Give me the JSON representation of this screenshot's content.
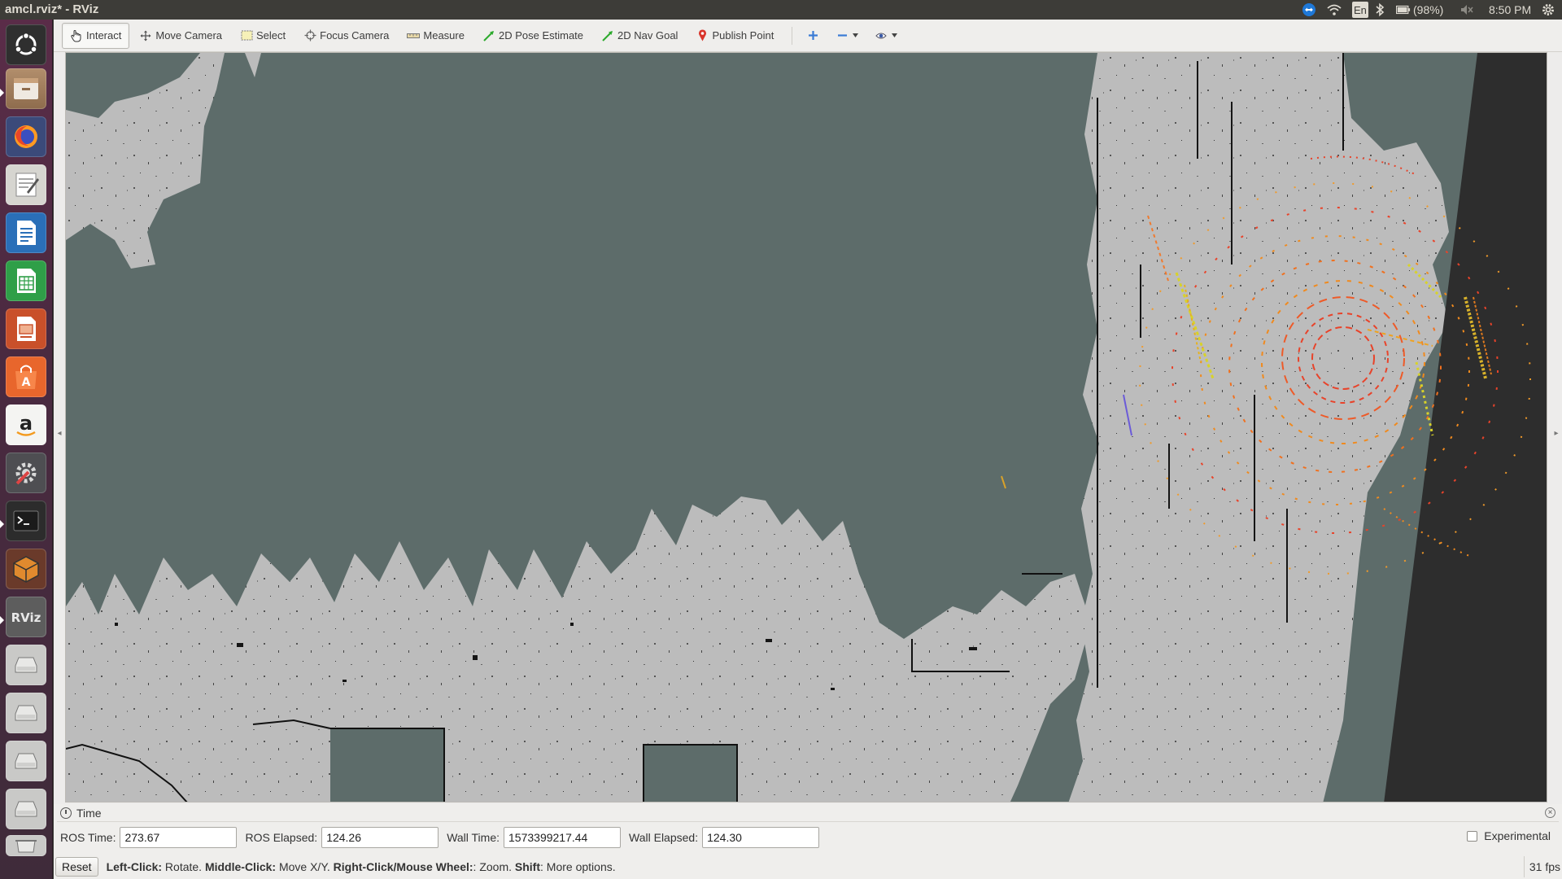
{
  "window": {
    "title": "amcl.rviz* - RViz"
  },
  "panel": {
    "keyboard_layout": "En",
    "battery_text": "(98%)",
    "clock": "8:50 PM"
  },
  "launcher": {
    "items": [
      {
        "name": "ubuntu-dash-icon",
        "color": "#3a3a3a"
      },
      {
        "name": "file-manager-icon",
        "color": "#9c7b5d"
      },
      {
        "name": "firefox-icon",
        "color": "#e6652b"
      },
      {
        "name": "text-editor-icon",
        "color": "#d8d8d2"
      },
      {
        "name": "libreoffice-writer-icon",
        "color": "#2a6fb8"
      },
      {
        "name": "libreoffice-calc-icon",
        "color": "#2f9f48"
      },
      {
        "name": "libreoffice-impress-icon",
        "color": "#c9502a"
      },
      {
        "name": "software-center-icon",
        "color": "#e8662c"
      },
      {
        "name": "amazon-icon",
        "color": "#ffffff"
      },
      {
        "name": "system-settings-icon",
        "color": "#c9484a"
      },
      {
        "name": "terminal-icon",
        "color": "#2c2c2c"
      },
      {
        "name": "virtualbox-icon",
        "color": "#e08a2e"
      },
      {
        "name": "rviz-icon",
        "color": "#6b6b6b"
      },
      {
        "name": "drive-icon-1",
        "color": "#bdbdbd"
      },
      {
        "name": "drive-icon-2",
        "color": "#bdbdbd"
      },
      {
        "name": "drive-icon-3",
        "color": "#bdbdbd"
      },
      {
        "name": "drive-icon-4",
        "color": "#bdbdbd"
      },
      {
        "name": "trash-icon",
        "color": "#bdbdbd"
      }
    ]
  },
  "toolbar": {
    "interact": "Interact",
    "move_camera": "Move Camera",
    "select": "Select",
    "focus_camera": "Focus Camera",
    "measure": "Measure",
    "pose_estimate": "2D Pose Estimate",
    "nav_goal": "2D Nav Goal",
    "publish_point": "Publish Point"
  },
  "time_panel": {
    "title": "Time",
    "ros_time_label": "ROS Time:",
    "ros_time": "273.67",
    "ros_elapsed_label": "ROS Elapsed:",
    "ros_elapsed": "124.26",
    "wall_time_label": "Wall Time:",
    "wall_time": "1573399217.44",
    "wall_elapsed_label": "Wall Elapsed:",
    "wall_elapsed": "124.30",
    "experimental_label": "Experimental"
  },
  "status": {
    "reset": "Reset",
    "left_click": "Left-Click:",
    "left_click_action": " Rotate. ",
    "middle_click": "Middle-Click:",
    "middle_click_action": " Move X/Y. ",
    "right_click": "Right-Click/Mouse Wheel:",
    "right_click_action": ": Zoom. ",
    "shift": "Shift",
    "shift_action": ": More options.",
    "fps": "31 fps"
  },
  "colors": {
    "map_unknown": "#5d6c6a",
    "map_free": "#bcbcbc",
    "map_occupied": "#111111",
    "scan_red": "#e8432a",
    "scan_orange": "#f08a1e",
    "scan_yellow": "#d8d22a"
  }
}
